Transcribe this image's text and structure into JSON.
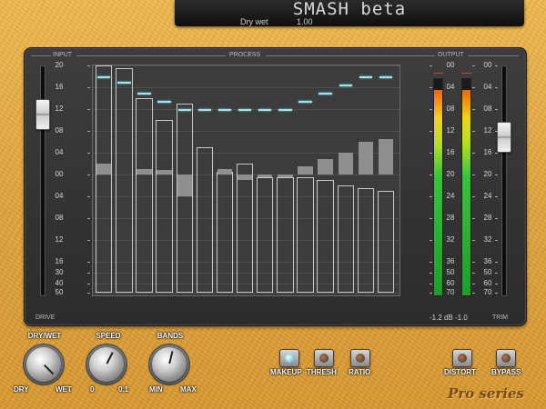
{
  "display": {
    "title": "SMASH beta",
    "param_name": "Dry wet",
    "param_value": "1.00"
  },
  "headers": {
    "input": "INPUT",
    "process": "PROCESS",
    "output": "OUTPUT"
  },
  "input_scale": [
    "20",
    "16",
    "12",
    "08",
    "04",
    "00",
    "04",
    "08",
    "12",
    "16",
    "30",
    "40",
    "50"
  ],
  "output_scale": [
    "00",
    "04",
    "08",
    "12",
    "16",
    "20",
    "24",
    "28",
    "32",
    "36",
    "50",
    "60",
    "70"
  ],
  "meter_scale": [
    "00",
    "04",
    "08",
    "12",
    "16",
    "20",
    "24",
    "28",
    "32",
    "36",
    "50",
    "60",
    "70"
  ],
  "footer": {
    "drive": "DRIVE",
    "trim": "TRIM",
    "readout": "-1.2 dB -1.0"
  },
  "faders": {
    "input_level": 0.17,
    "output_level": 0.28
  },
  "meters": {
    "left_level": 0.95,
    "right_level": 0.95
  },
  "process": {
    "band_box_tops": [
      20,
      19,
      14,
      10,
      13,
      5,
      0,
      2,
      -1,
      -1,
      -1,
      -2,
      -2
    ],
    "band_box_bottoms": [
      -50,
      -50,
      -50,
      -50,
      -50,
      -50,
      -50,
      -50,
      -50,
      -50,
      -50,
      -50,
      -50
    ],
    "gain_reduction": [
      [
        2,
        0
      ],
      [
        0,
        0
      ],
      [
        1,
        0
      ],
      [
        0.8,
        0
      ],
      [
        0,
        -4
      ],
      [
        0,
        0
      ],
      [
        1,
        0
      ],
      [
        0,
        -1
      ],
      [
        0,
        -0.5
      ],
      [
        0,
        -0.5
      ],
      [
        1.5,
        0
      ],
      [
        2.8,
        0
      ],
      [
        4,
        0
      ],
      [
        6,
        0
      ],
      [
        6.5,
        0
      ]
    ],
    "thresholds": [
      18,
      17,
      15,
      13.5,
      12,
      12,
      12,
      12,
      12,
      12,
      13.5,
      15,
      16.5,
      18,
      18
    ]
  },
  "knobs": [
    {
      "label": "DRY/WET",
      "min": "DRY",
      "max": "WET",
      "value": 1.0
    },
    {
      "label": "SPEED",
      "min": "0",
      "max": "0.1",
      "value": 0.6
    },
    {
      "label": "BANDS",
      "min": "MIN",
      "max": "MAX",
      "value": 0.55
    }
  ],
  "buttons": {
    "makeup": {
      "label": "MAKEUP",
      "on": true
    },
    "thresh": {
      "label": "THRESH",
      "on": false
    },
    "ratio": {
      "label": "RATIO",
      "on": false
    },
    "distort": {
      "label": "DISTORT",
      "on": false
    },
    "bypass": {
      "label": "BYPASS",
      "on": false
    }
  },
  "brand": "Pro series",
  "colors": {
    "threshold": "#9fe6ea",
    "led_on": "#7fd6ea"
  }
}
